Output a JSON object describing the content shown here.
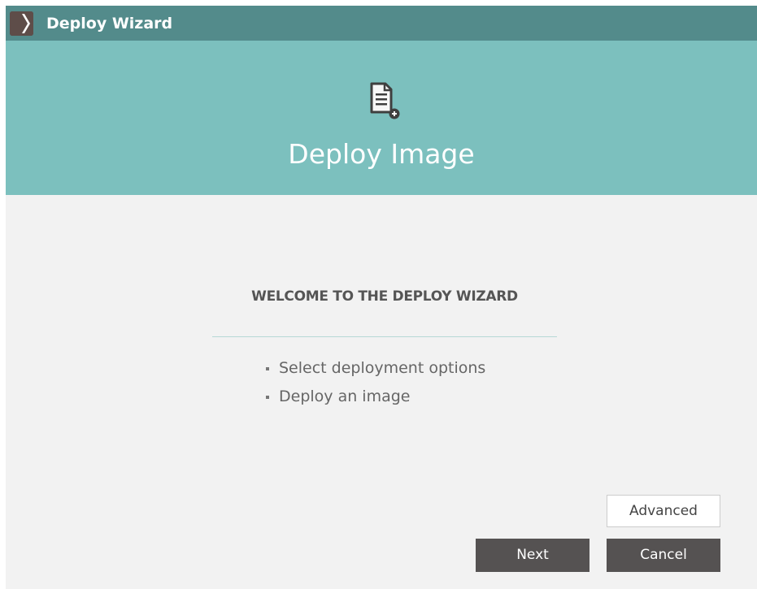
{
  "window": {
    "title": "Deploy Wizard",
    "app_icon": "chevron-right-icon"
  },
  "banner": {
    "icon": "document-add-icon",
    "title": "Deploy Image"
  },
  "content": {
    "heading": "WELCOME TO THE DEPLOY WIZARD",
    "steps": [
      {
        "label": "Select deployment options"
      },
      {
        "label": "Deploy an image"
      }
    ]
  },
  "buttons": {
    "advanced": "Advanced",
    "next": "Next",
    "cancel": "Cancel"
  },
  "colors": {
    "titlebar": "#538b8b",
    "banner": "#7cc0be",
    "body_background": "#f2f2f2",
    "button_dark": "#555252"
  }
}
